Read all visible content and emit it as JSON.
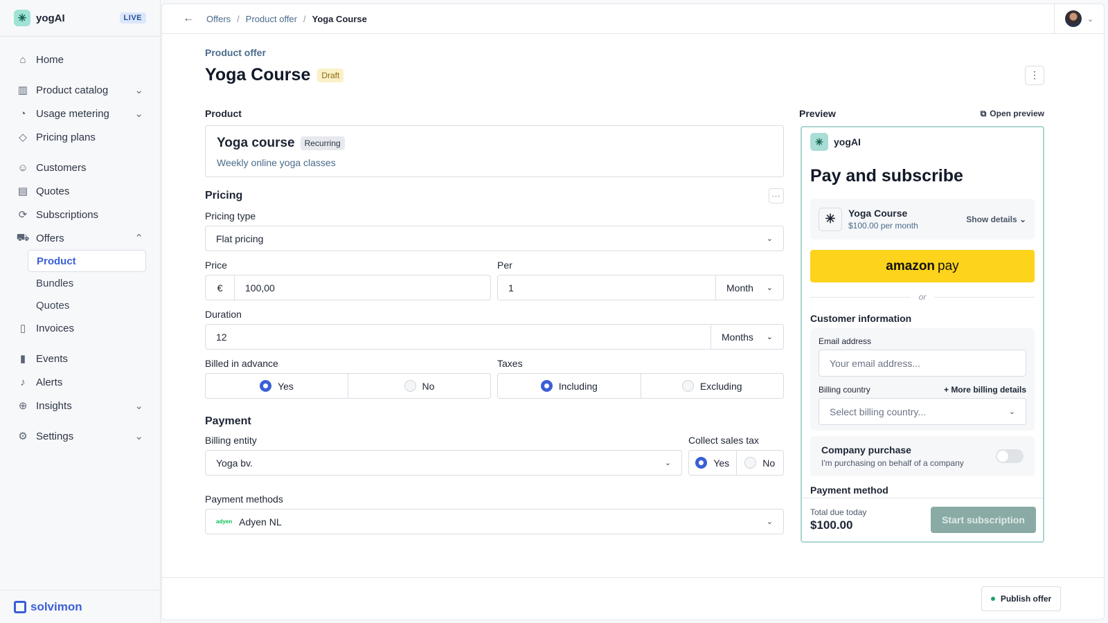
{
  "sidebar": {
    "brand": "yogAI",
    "env_badge": "LIVE",
    "nav": [
      {
        "label": "Home",
        "icon": "home-icon"
      },
      {
        "label": "Product catalog",
        "icon": "barcode-icon"
      },
      {
        "label": "Usage metering",
        "icon": "gauge-icon"
      },
      {
        "label": "Pricing plans",
        "icon": "tag-icon"
      },
      {
        "label": "Customers",
        "icon": "users-icon"
      },
      {
        "label": "Quotes",
        "icon": "receipt-icon"
      },
      {
        "label": "Subscriptions",
        "icon": "refresh-icon"
      },
      {
        "label": "Offers",
        "icon": "cart-icon"
      },
      {
        "label": "Invoices",
        "icon": "file-icon"
      },
      {
        "label": "Events",
        "icon": "bar-chart-icon"
      },
      {
        "label": "Alerts",
        "icon": "bell-icon"
      },
      {
        "label": "Insights",
        "icon": "zoom-icon"
      },
      {
        "label": "Settings",
        "icon": "gear-icon"
      }
    ],
    "offers_sub": [
      {
        "label": "Product",
        "active": true
      },
      {
        "label": "Bundles",
        "active": false
      },
      {
        "label": "Quotes",
        "active": false
      }
    ],
    "footer_brand": "solvimon"
  },
  "breadcrumb": [
    "Offers",
    "Product offer",
    "Yoga Course"
  ],
  "page": {
    "subtitle": "Product offer",
    "title": "Yoga Course",
    "status": "Draft"
  },
  "product": {
    "section_label": "Product",
    "name": "Yoga course",
    "badge": "Recurring",
    "description": "Weekly online yoga classes"
  },
  "pricing": {
    "title": "Pricing",
    "more_label": "···",
    "type_label": "Pricing type",
    "type_value": "Flat pricing",
    "price_label": "Price",
    "currency": "€",
    "price_value": "100,00",
    "per_label": "Per",
    "per_value": "1",
    "per_unit": "Month",
    "duration_label": "Duration",
    "duration_value": "12",
    "duration_unit": "Months",
    "billed_label": "Billed in advance",
    "billed_yes": "Yes",
    "billed_no": "No",
    "taxes_label": "Taxes",
    "taxes_including": "Including",
    "taxes_excluding": "Excluding"
  },
  "payment": {
    "title": "Payment",
    "entity_label": "Billing entity",
    "entity_value": "Yoga bv.",
    "sales_tax_label": "Collect sales tax",
    "tax_yes": "Yes",
    "tax_no": "No",
    "methods_label": "Payment methods",
    "method_logo": "adyen",
    "method_value": "Adyen NL"
  },
  "preview": {
    "label": "Preview",
    "open_label": "Open preview",
    "brand": "yogAI",
    "title": "Pay and subscribe",
    "item_name": "Yoga Course",
    "item_price": "$100.00 per month",
    "show_details": "Show details",
    "amazon_brand": "amazon",
    "amazon_pay": "pay",
    "or_text": "or",
    "customer_info": "Customer information",
    "email_label": "Email address",
    "email_placeholder": "Your email address...",
    "country_label": "Billing country",
    "more_billing": "More billing details",
    "country_placeholder": "Select billing country...",
    "company_title": "Company purchase",
    "company_desc": "I'm purchasing on behalf of a company",
    "payment_method": "Payment method",
    "total_label": "Total due today",
    "total_value": "$100.00",
    "start_button": "Start subscription"
  },
  "publish_button": "Publish offer",
  "colors": {
    "accent": "#3b5fd6",
    "brand_teal": "#9fe3d5",
    "amazon": "#fdd31b"
  }
}
